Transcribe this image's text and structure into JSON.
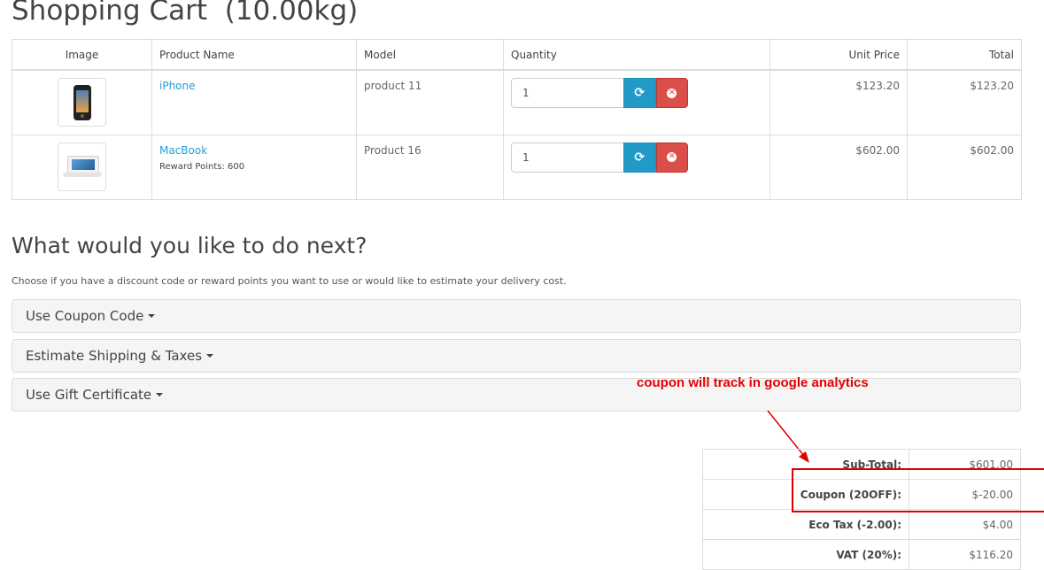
{
  "page_title": "Shopping Cart  (10.00kg)",
  "cart": {
    "headers": {
      "image": "Image",
      "name": "Product Name",
      "model": "Model",
      "quantity": "Quantity",
      "unit_price": "Unit Price",
      "total": "Total"
    },
    "rows": [
      {
        "name": "iPhone",
        "reward": "",
        "model": "product 11",
        "quantity": "1",
        "unit_price": "$123.20",
        "total": "$123.20"
      },
      {
        "name": "MacBook",
        "reward": "Reward Points: 600",
        "model": "Product 16",
        "quantity": "1",
        "unit_price": "$602.00",
        "total": "$602.00"
      }
    ]
  },
  "next": {
    "heading": "What would you like to do next?",
    "description": "Choose if you have a discount code or reward points you want to use or would like to estimate your delivery cost.",
    "panels": [
      "Use Coupon Code",
      "Estimate Shipping & Taxes",
      "Use Gift Certificate"
    ]
  },
  "annotation": "coupon will track in google analytics",
  "totals": [
    {
      "label": "Sub-Total:",
      "value": "$601.00"
    },
    {
      "label": "Coupon (20OFF):",
      "value": "$-20.00"
    },
    {
      "label": "Eco Tax (-2.00):",
      "value": "$4.00"
    },
    {
      "label": "VAT (20%):",
      "value": "$116.20"
    }
  ],
  "colors": {
    "link": "#23a1d1",
    "update_button": "#229ac8",
    "remove_button": "#da4f49",
    "annotation": "#e60000"
  },
  "icons": {
    "update": "refresh-icon",
    "remove": "times-circle-icon",
    "panel_toggle": "caret-down-icon"
  }
}
